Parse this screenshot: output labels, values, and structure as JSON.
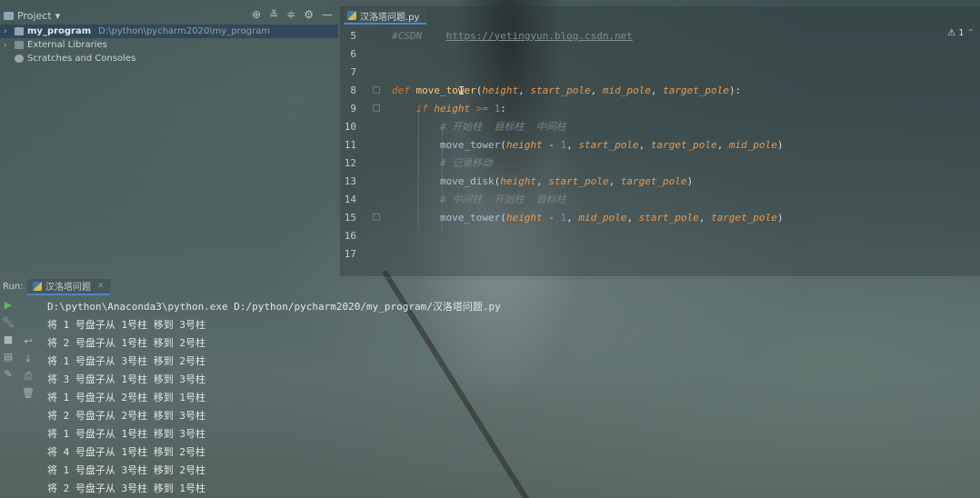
{
  "project_panel": {
    "title": "Project",
    "tree": [
      {
        "name": "my_program",
        "path": "D:\\python\\pycharm2020\\my_program"
      },
      {
        "name": "External Libraries"
      },
      {
        "name": "Scratches and Consoles"
      }
    ]
  },
  "editor": {
    "tab_label": "汉洛塔问题.py",
    "inspection": "1",
    "lines": [
      {
        "n": "5"
      },
      {
        "n": "6"
      },
      {
        "n": "7"
      },
      {
        "n": "8"
      },
      {
        "n": "9"
      },
      {
        "n": "10"
      },
      {
        "n": "11"
      },
      {
        "n": "12"
      },
      {
        "n": "13"
      },
      {
        "n": "14"
      },
      {
        "n": "15"
      },
      {
        "n": "16"
      },
      {
        "n": "17"
      }
    ],
    "code": {
      "l5_comment": "#CSDN",
      "l5_url": "https://yetingyun.blog.csdn.net",
      "l8_def": "def",
      "l8_fn": "move_tower",
      "l8_p1": "height",
      "l8_p2": "start_pole",
      "l8_p3": "mid_pole",
      "l8_p4": "target_pole",
      "l9_if": "if",
      "l9_var": "height",
      "l9_op": ">=",
      "l9_num": "1",
      "l10_cmt": "# 开始柱  目标柱  中间柱",
      "l11_fn": "move_tower",
      "l11_a1": "height",
      "l11_num": "1",
      "l11_a2": "start_pole",
      "l11_a3": "target_pole",
      "l11_a4": "mid_pole",
      "l12_cmt": "# 记录移动",
      "l13_fn": "move_disk",
      "l13_a1": "height",
      "l13_a2": "start_pole",
      "l13_a3": "target_pole",
      "l14_cmt": "# 中间柱  开始柱  目标柱",
      "l15_fn": "move_tower",
      "l15_a1": "height",
      "l15_num": "1",
      "l15_a2": "mid_pole",
      "l15_a3": "start_pole",
      "l15_a4": "target_pole"
    }
  },
  "run_panel": {
    "label": "Run:",
    "tab_label": "汉洛塔问题",
    "console": [
      "D:\\python\\Anaconda3\\python.exe D:/python/pycharm2020/my_program/汉洛塔问题.py",
      "将 1 号盘子从 1号柱 移到 3号柱",
      "将 2 号盘子从 1号柱 移到 2号柱",
      "将 1 号盘子从 3号柱 移到 2号柱",
      "将 3 号盘子从 1号柱 移到 3号柱",
      "将 1 号盘子从 2号柱 移到 1号柱",
      "将 2 号盘子从 2号柱 移到 3号柱",
      "将 1 号盘子从 1号柱 移到 3号柱",
      "将 4 号盘子从 1号柱 移到 2号柱",
      "将 1 号盘子从 3号柱 移到 2号柱",
      "将 2 号盘子从 3号柱 移到 1号柱"
    ]
  }
}
